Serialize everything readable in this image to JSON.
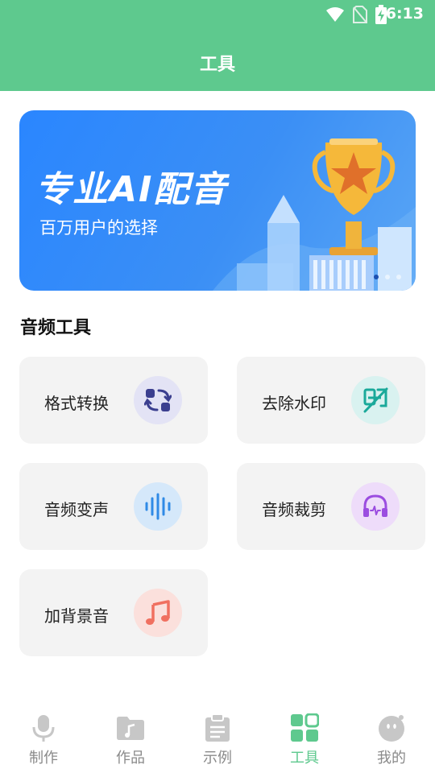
{
  "status_bar": {
    "time": "6:13"
  },
  "header": {
    "title": "工具"
  },
  "banner": {
    "title": "专业AI配音",
    "subtitle": "百万用户的选择",
    "slide_count": 3,
    "active_slide": 1
  },
  "section": {
    "title": "音频工具"
  },
  "tools": [
    {
      "label": "格式转换",
      "icon": "convert-icon",
      "icon_color": "#3b3f8f",
      "icon_bg": "#e3e3f5"
    },
    {
      "label": "去除水印",
      "icon": "remove-watermark-icon",
      "icon_color": "#1aa99a",
      "icon_bg": "#d9f2f0"
    },
    {
      "label": "音频变声",
      "icon": "voice-wave-icon",
      "icon_color": "#2f8ae6",
      "icon_bg": "#d5e8fa"
    },
    {
      "label": "音频裁剪",
      "icon": "headphones-icon",
      "icon_color": "#9b4de0",
      "icon_bg": "#eedcfa"
    },
    {
      "label": "加背景音",
      "icon": "music-note-icon",
      "icon_color": "#f07060",
      "icon_bg": "#fbe0dc"
    }
  ],
  "nav": [
    {
      "label": "制作",
      "icon": "microphone-icon"
    },
    {
      "label": "作品",
      "icon": "folder-music-icon"
    },
    {
      "label": "示例",
      "icon": "clipboard-icon"
    },
    {
      "label": "工具",
      "icon": "grid-icon",
      "active": true
    },
    {
      "label": "我的",
      "icon": "profile-face-icon"
    }
  ],
  "colors": {
    "brand": "#5ec98e",
    "banner": "#2a86ff",
    "inactive": "#bdbdbd"
  }
}
